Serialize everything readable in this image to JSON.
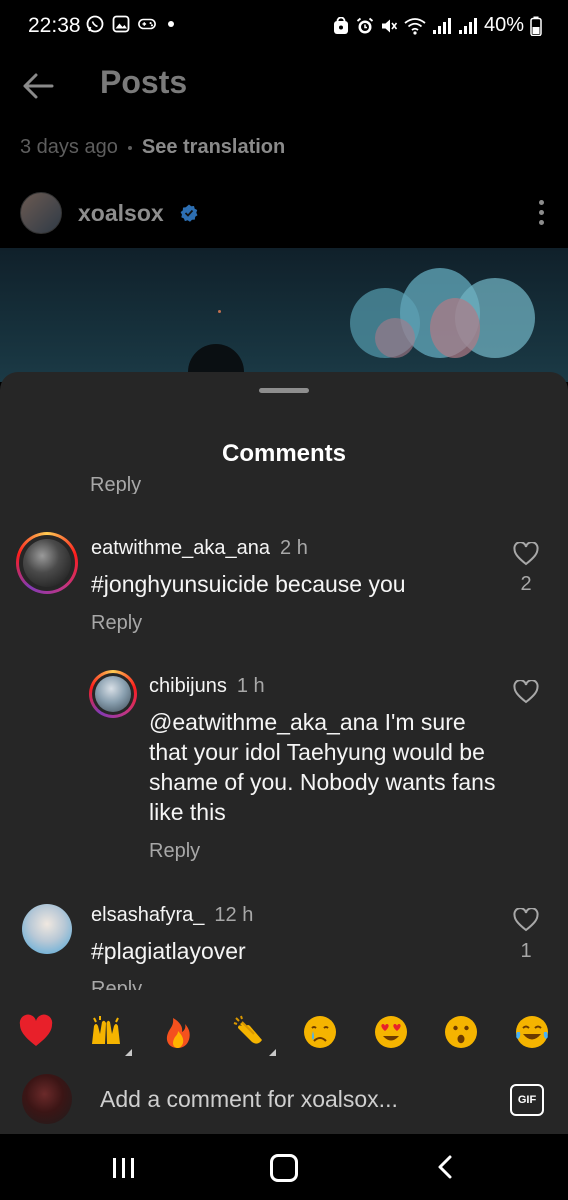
{
  "status_bar": {
    "time": "22:38",
    "battery": "40%"
  },
  "header": {
    "title": "Posts",
    "post_age": "3 days ago",
    "translation_link": "See translation"
  },
  "author": {
    "username": "xoalsox"
  },
  "sheet": {
    "title": "Comments",
    "cutoff_reply": "Reply"
  },
  "comments": [
    {
      "username": "eatwithme_aka_ana",
      "time": "2 h",
      "text": "#jonghyunsuicide because you",
      "reply_label": "Reply",
      "likes": "2"
    },
    {
      "username": "chibijuns",
      "time": "1 h",
      "text": "@eatwithme_aka_ana I'm sure that your idol Taehyung would be shame of you. Nobody wants fans like this",
      "reply_label": "Reply",
      "likes": ""
    },
    {
      "username": "elsashafyra_",
      "time": "12 h",
      "text": "#plagiatlayover",
      "reply_label": "Reply",
      "likes": "1"
    }
  ],
  "emoji_bar": [
    "❤️",
    "🙌",
    "🔥",
    "👏",
    "😢",
    "😍",
    "😮",
    "😂"
  ],
  "composer": {
    "placeholder": "Add a comment for xoalsox...",
    "gif_label": "GIF"
  },
  "colors": {
    "sheet_bg": "#262626",
    "text_secondary": "#a8a8a8",
    "verified_blue": "#3897f0"
  }
}
